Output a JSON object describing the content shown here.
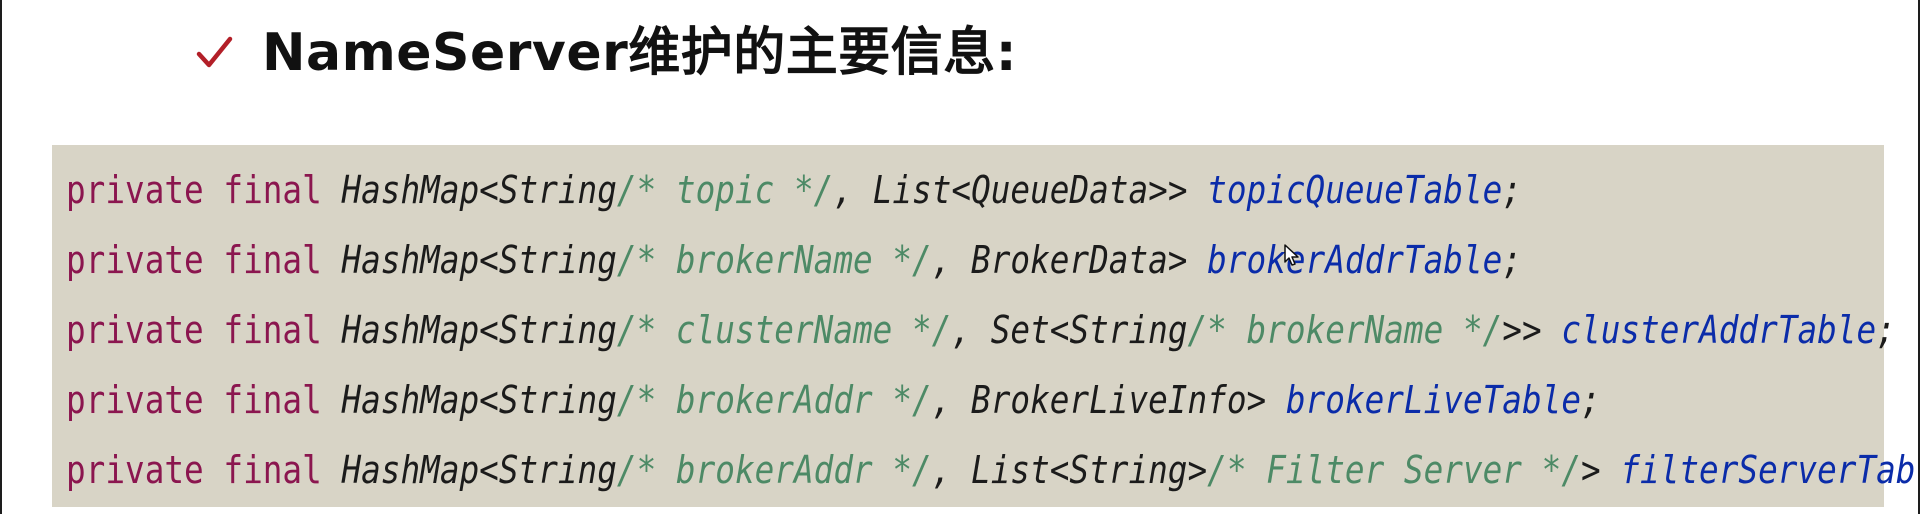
{
  "slide": {
    "title": "NameServer维护的主要信息:",
    "check_icon": "check-mark-icon",
    "colors": {
      "check": "#b31f28",
      "code_background": "#d8d4c6",
      "keyword": "#8b164f",
      "type": "#1b1b1b",
      "comment": "#4d8a66",
      "field": "#0b2ca9"
    }
  },
  "code": {
    "lines": [
      [
        {
          "text": "private final ",
          "kind": "keyword"
        },
        {
          "text": "HashMap<String",
          "kind": "type"
        },
        {
          "text": "/* topic */",
          "kind": "comment"
        },
        {
          "text": ", List<QueueData>> ",
          "kind": "type"
        },
        {
          "text": "topicQueueTable",
          "kind": "field"
        },
        {
          "text": ";",
          "kind": "punct"
        }
      ],
      [
        {
          "text": "private final ",
          "kind": "keyword"
        },
        {
          "text": "HashMap<String",
          "kind": "type"
        },
        {
          "text": "/* brokerName */",
          "kind": "comment"
        },
        {
          "text": ", BrokerData> ",
          "kind": "type"
        },
        {
          "text": "brokerAddrTable",
          "kind": "field"
        },
        {
          "text": ";",
          "kind": "punct"
        }
      ],
      [
        {
          "text": "private final ",
          "kind": "keyword"
        },
        {
          "text": "HashMap<String",
          "kind": "type"
        },
        {
          "text": "/* clusterName */",
          "kind": "comment"
        },
        {
          "text": ", Set<String",
          "kind": "type"
        },
        {
          "text": "/* brokerName */",
          "kind": "comment"
        },
        {
          "text": ">> ",
          "kind": "type"
        },
        {
          "text": "clusterAddrTable",
          "kind": "field"
        },
        {
          "text": ";",
          "kind": "punct"
        }
      ],
      [
        {
          "text": "private final ",
          "kind": "keyword"
        },
        {
          "text": "HashMap<String",
          "kind": "type"
        },
        {
          "text": "/* brokerAddr */",
          "kind": "comment"
        },
        {
          "text": ", BrokerLiveInfo> ",
          "kind": "type"
        },
        {
          "text": "brokerLiveTable",
          "kind": "field"
        },
        {
          "text": ";",
          "kind": "punct"
        }
      ],
      [
        {
          "text": "private final ",
          "kind": "keyword"
        },
        {
          "text": "HashMap<String",
          "kind": "type"
        },
        {
          "text": "/* brokerAddr */",
          "kind": "comment"
        },
        {
          "text": ", List<String>",
          "kind": "type"
        },
        {
          "text": "/* Filter Server */",
          "kind": "comment"
        },
        {
          "text": "> ",
          "kind": "type"
        },
        {
          "text": "filterServerTable",
          "kind": "field"
        },
        {
          "text": ";",
          "kind": "punct"
        }
      ]
    ]
  },
  "pointer": {
    "icon": "mouse-pointer-icon"
  }
}
